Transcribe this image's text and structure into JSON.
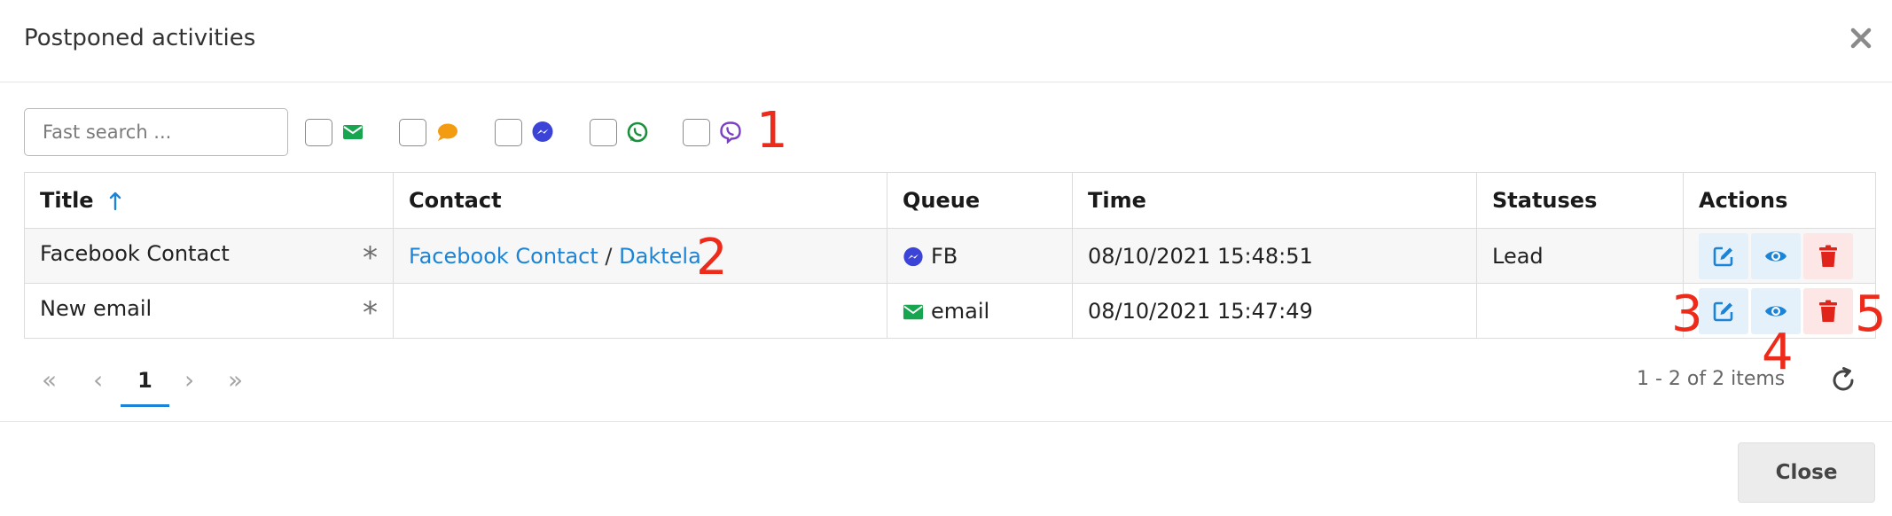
{
  "dialog": {
    "title": "Postponed activities",
    "close_icon": "close-icon"
  },
  "toolbar": {
    "search_placeholder": "Fast search ...",
    "search_value": "",
    "channels": [
      {
        "name": "email",
        "icon": "email-icon",
        "color": "#18a550",
        "checked": false
      },
      {
        "name": "chat",
        "icon": "chat-bubble-icon",
        "color": "#f39c12",
        "checked": false
      },
      {
        "name": "messenger",
        "icon": "messenger-icon",
        "color": "#3b44d6",
        "checked": false
      },
      {
        "name": "whatsapp",
        "icon": "whatsapp-icon",
        "color": "#1a8f3c",
        "checked": false
      },
      {
        "name": "viber",
        "icon": "viber-icon",
        "color": "#7b3fc4",
        "checked": false
      }
    ]
  },
  "annotations": [
    "1",
    "2",
    "3",
    "4",
    "5"
  ],
  "table": {
    "columns": [
      "Title",
      "Contact",
      "Queue",
      "Time",
      "Statuses",
      "Actions"
    ],
    "sort": {
      "column": "Title",
      "direction": "asc",
      "icon": "sort-up-arrow-icon"
    },
    "rows": [
      {
        "title": "Facebook Contact",
        "marker": "*",
        "contact_name": "Facebook Contact",
        "contact_sep": "/",
        "contact_company": "Daktela",
        "queue": "FB",
        "queue_icon": "messenger-icon",
        "time": "08/10/2021 15:48:51",
        "status": "Lead"
      },
      {
        "title": "New email",
        "marker": "*",
        "contact_name": "",
        "contact_sep": "",
        "contact_company": "",
        "queue": "email",
        "queue_icon": "email-icon",
        "time": "08/10/2021 15:47:49",
        "status": ""
      }
    ],
    "action_icons": [
      "edit-icon",
      "view-eye-icon",
      "delete-trash-icon"
    ]
  },
  "pager": {
    "first": "«",
    "prev": "‹",
    "current_page": "1",
    "next": "›",
    "last": "»",
    "items_info": "1 - 2 of 2 items",
    "refresh_icon": "refresh-icon"
  },
  "footer": {
    "close_label": "Close"
  },
  "colors": {
    "link": "#1b84d6",
    "annotation": "#ee2a1a",
    "delete": "#e0241b",
    "action_blue": "#1b84d6"
  }
}
